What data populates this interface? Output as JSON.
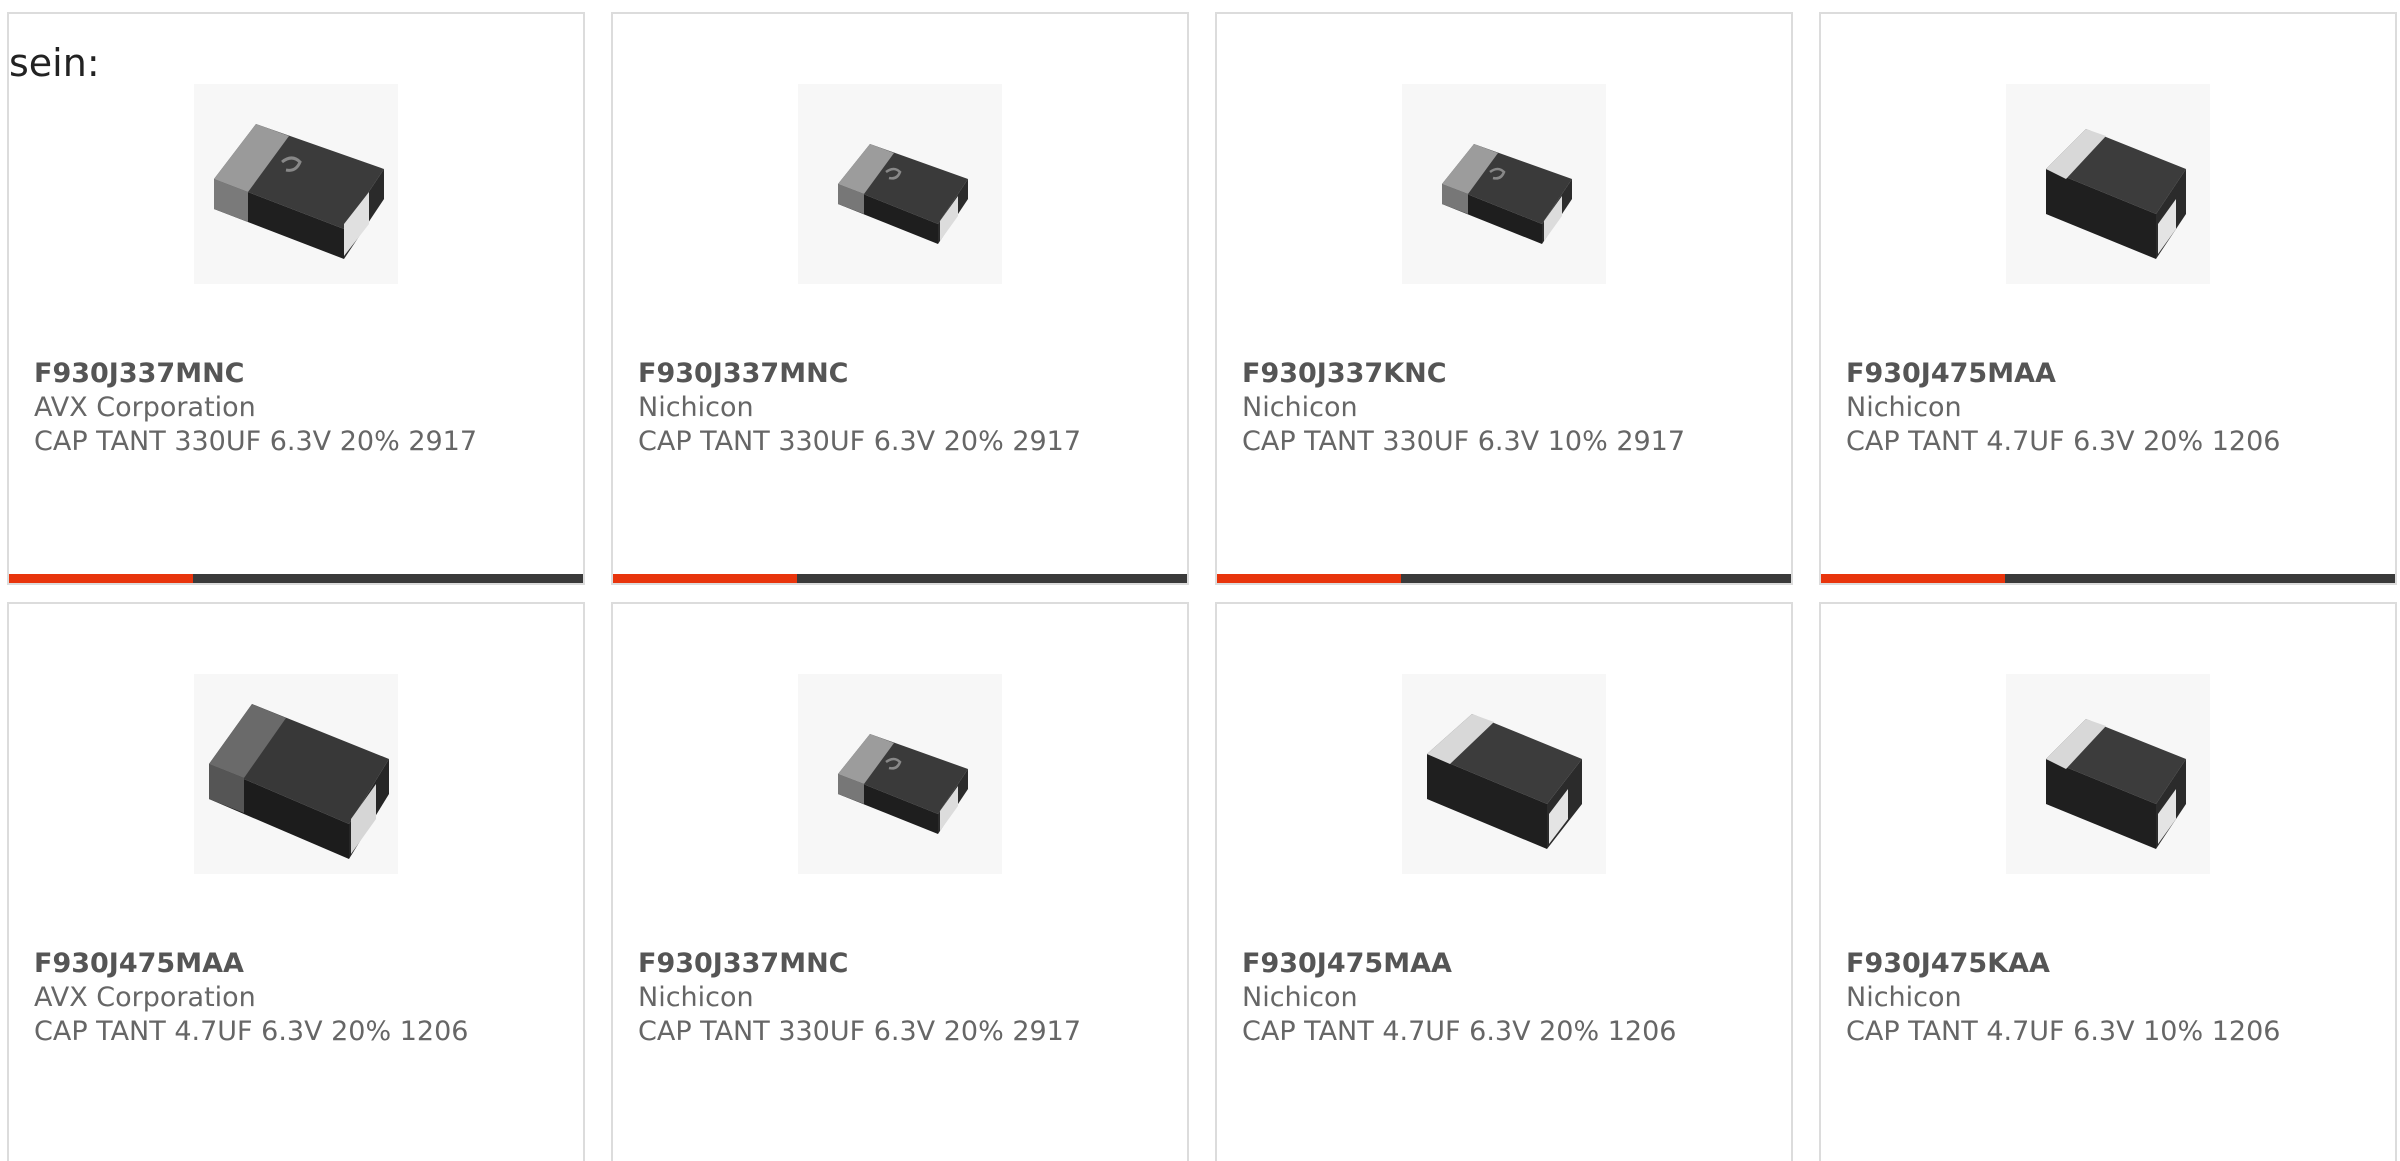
{
  "intro_text": "sein:",
  "colors": {
    "accent": "#e8340c",
    "bar_track": "#3a3a3a",
    "card_border": "#dcdcdc",
    "part_text": "#555555",
    "secondary_text": "#666666"
  },
  "products": [
    {
      "part_number": "F930J337MNC",
      "manufacturer": "AVX Corporation",
      "description": "CAP TANT 330UF 6.3V 20% 2917",
      "image_icon": "tantalum-capacitor-large-icon",
      "progress": 0.32
    },
    {
      "part_number": "F930J337MNC",
      "manufacturer": "Nichicon",
      "description": "CAP TANT 330UF 6.3V 20% 2917",
      "image_icon": "tantalum-capacitor-small-icon",
      "progress": 0.32
    },
    {
      "part_number": "F930J337KNC",
      "manufacturer": "Nichicon",
      "description": "CAP TANT 330UF 6.3V 10% 2917",
      "image_icon": "tantalum-capacitor-small-icon",
      "progress": 0.32
    },
    {
      "part_number": "F930J475MAA",
      "manufacturer": "Nichicon",
      "description": "CAP TANT 4.7UF 6.3V 20% 1206",
      "image_icon": "tantalum-capacitor-cube-icon",
      "progress": 0.32
    },
    {
      "part_number": "F930J475MAA",
      "manufacturer": "AVX Corporation",
      "description": "CAP TANT 4.7UF 6.3V 20% 1206",
      "image_icon": "tantalum-capacitor-large-icon"
    },
    {
      "part_number": "F930J337MNC",
      "manufacturer": "Nichicon",
      "description": "CAP TANT 330UF 6.3V 20% 2917",
      "image_icon": "tantalum-capacitor-small-icon"
    },
    {
      "part_number": "F930J475MAA",
      "manufacturer": "Nichicon",
      "description": "CAP TANT 4.7UF 6.3V 20% 1206",
      "image_icon": "tantalum-capacitor-cube-icon"
    },
    {
      "part_number": "F930J475KAA",
      "manufacturer": "Nichicon",
      "description": "CAP TANT 4.7UF 6.3V 10% 1206",
      "image_icon": "tantalum-capacitor-cube-icon"
    }
  ]
}
